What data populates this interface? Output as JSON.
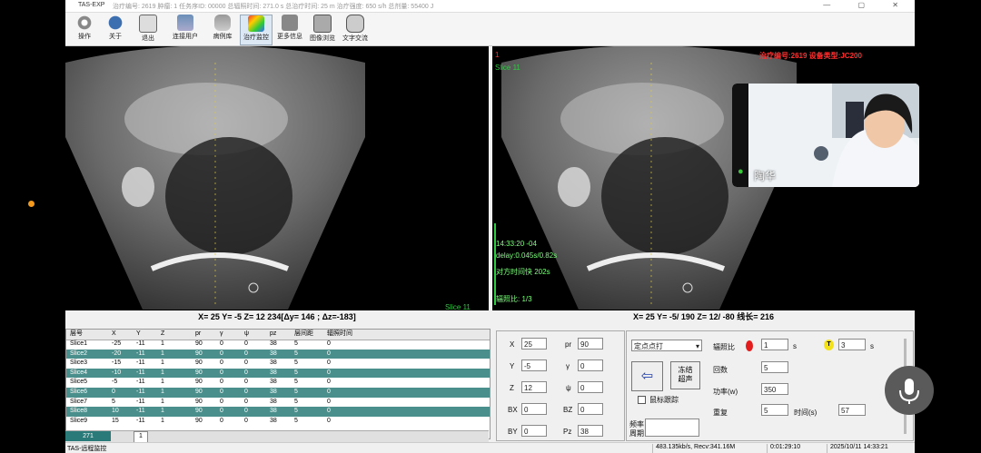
{
  "window": {
    "app_name": "TAS-EXP",
    "info_bar": "治疗编号: 2619 肿瘤: 1 任务序ID: 00000 总辐照时间: 271.0 s 总治疗时间: 25 m 治疗强度: 650 s/h 总剂量: 55400 J",
    "controls": "— ▢ ✕"
  },
  "toolbar": [
    {
      "label": "操作",
      "icon": "gear-icon"
    },
    {
      "label": "关于",
      "icon": "help-icon"
    },
    {
      "label": "退出",
      "icon": "exit-icon"
    },
    {
      "label": "连接用户",
      "icon": "network-icon"
    },
    {
      "label": "病例库",
      "icon": "database-icon"
    },
    {
      "label": "治疗监控",
      "icon": "monitor-icon"
    },
    {
      "label": "更多信息",
      "icon": "info-icon"
    },
    {
      "label": "图像浏览",
      "icon": "image-icon"
    },
    {
      "label": "文字交流",
      "icon": "chat-icon"
    }
  ],
  "tools": {
    "t1": "◠",
    "t2": "◯",
    "t3": "▬",
    "t4": "▭"
  },
  "left_view": {
    "slice_label": "Slice 11",
    "coords": "X= 25 Y= -5 Z= 12 234[Δy= 146 ; Δz=-183]"
  },
  "right_view": {
    "slice_label": "Slice 11",
    "marker": "1",
    "header_red": "治疗编号:2619 设备类型:JC200",
    "time": "14:33:20 -04",
    "delay": "delay:0.045s/0.82s",
    "clock_diff": "对方时间快 202s",
    "ratio": "辐照比: 1/3",
    "coords": "X= 25 Y= -5/ 190 Z= 12/ -80 线长= 216"
  },
  "video": {
    "name": "陶华"
  },
  "table": {
    "headers": [
      "层号",
      "X",
      "Y",
      "Z",
      "pr",
      "γ",
      "ψ",
      "pz",
      "层间距",
      "辐照时间"
    ],
    "rows": [
      [
        "Slice1",
        "-25",
        "-11",
        "1",
        "90",
        "0",
        "0",
        "38",
        "5",
        "0"
      ],
      [
        "Slice2",
        "-20",
        "-11",
        "1",
        "90",
        "0",
        "0",
        "38",
        "5",
        "0"
      ],
      [
        "Slice3",
        "-15",
        "-11",
        "1",
        "90",
        "0",
        "0",
        "38",
        "5",
        "0"
      ],
      [
        "Slice4",
        "-10",
        "-11",
        "1",
        "90",
        "0",
        "0",
        "38",
        "5",
        "0"
      ],
      [
        "Slice5",
        "-5",
        "-11",
        "1",
        "90",
        "0",
        "0",
        "38",
        "5",
        "0"
      ],
      [
        "Slice6",
        "0",
        "-11",
        "1",
        "90",
        "0",
        "0",
        "38",
        "5",
        "0"
      ],
      [
        "Slice7",
        "5",
        "-11",
        "1",
        "90",
        "0",
        "0",
        "38",
        "5",
        "0"
      ],
      [
        "Slice8",
        "10",
        "-11",
        "1",
        "90",
        "0",
        "0",
        "38",
        "5",
        "0"
      ],
      [
        "Slice9",
        "15",
        "-11",
        "1",
        "90",
        "0",
        "0",
        "38",
        "5",
        "0"
      ]
    ],
    "tab_count": "271",
    "tab_page": "1"
  },
  "params": {
    "X": "25",
    "pr": "90",
    "Y": "-5",
    "gamma": "0",
    "Z": "12",
    "psi": "0",
    "BX": "0",
    "BZ": "0",
    "BY": "0",
    "Pz": "38",
    "lbl_X": "X",
    "lbl_pr": "pr",
    "lbl_Y": "Y",
    "lbl_gamma": "γ",
    "lbl_Z": "Z",
    "lbl_psi": "ψ",
    "lbl_BX": "BX",
    "lbl_BZ": "BZ",
    "lbl_BY": "BY",
    "lbl_Pz": "Pz",
    "freq_label1": "频率",
    "freq_label2": "周期"
  },
  "control": {
    "mode_select": "定点点打",
    "freeze_button": "冻结\n超声",
    "mouse_track": "鼠标跟踪",
    "ratio_label": "辐照比",
    "ratio_a": "1",
    "ratio_a_unit": "s",
    "ratio_t": "T",
    "ratio_b": "3",
    "ratio_b_unit": "s",
    "count_label": "回数",
    "count": "5",
    "power_label": "功率(w)",
    "power": "350",
    "repeat_label": "重复",
    "repeat": "5",
    "time_label": "时间(s)",
    "time": "57"
  },
  "status": {
    "left": "TAS-远程监控",
    "rate": "483.135kb/s, Recv:341.16M",
    "elapsed": "0:01:29:10",
    "datetime": "2025/10/11 14:33:21"
  }
}
